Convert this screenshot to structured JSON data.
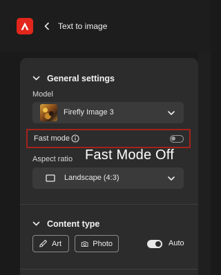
{
  "header": {
    "title": "Text to image",
    "logo_icon": "adobe-firefly-logo",
    "back_icon": "chevron-left-icon",
    "brand_color": "#e3261c"
  },
  "general_settings": {
    "title": "General settings",
    "model": {
      "label": "Model",
      "value": "Firefly Image 3"
    },
    "fast_mode": {
      "label": "Fast mode",
      "enabled": false,
      "highlight_color": "#a3231d"
    },
    "aspect_ratio": {
      "label": "Aspect ratio",
      "value": "Landscape (4:3)"
    }
  },
  "annotation": {
    "text": "Fast Mode Off"
  },
  "content_type": {
    "title": "Content type",
    "art_label": "Art",
    "photo_label": "Photo",
    "auto_label": "Auto",
    "auto_enabled": true
  }
}
